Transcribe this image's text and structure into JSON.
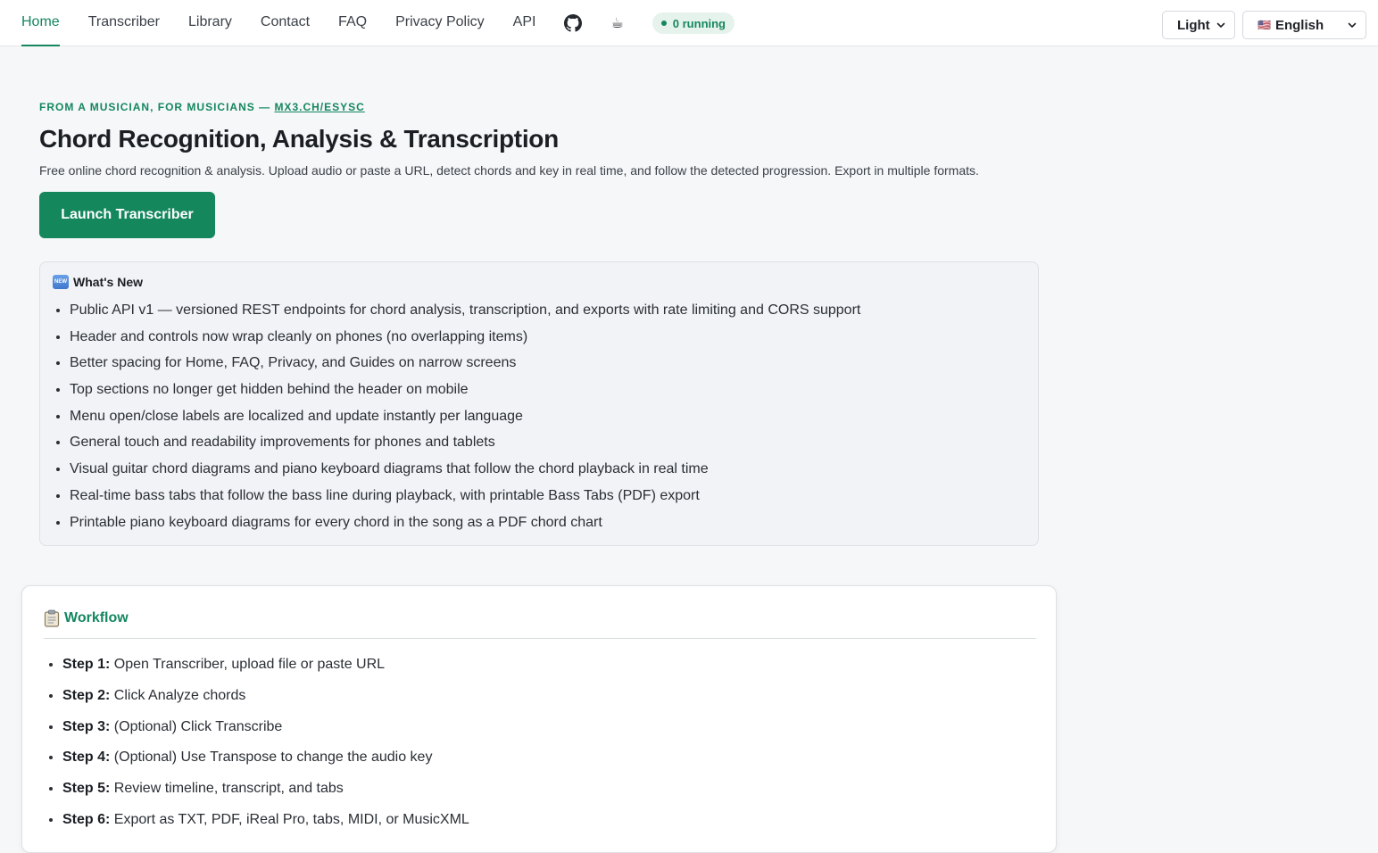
{
  "nav": {
    "items": [
      {
        "label": "Home",
        "active": true
      },
      {
        "label": "Transcriber"
      },
      {
        "label": "Library"
      },
      {
        "label": "Contact"
      },
      {
        "label": "FAQ"
      },
      {
        "label": "Privacy Policy"
      },
      {
        "label": "API"
      }
    ],
    "github_icon": "github-icon",
    "coffee_icon": "coffee-icon",
    "running_status": "0 running",
    "theme_select": "Light",
    "language_flag": "🇺🇸",
    "language_select": "English"
  },
  "hero": {
    "eyebrow_text": "FROM A MUSICIAN, FOR MUSICIANS — ",
    "eyebrow_link": "MX3.CH/ESYSC",
    "title": "Chord Recognition, Analysis & Transcription",
    "subtitle": "Free online chord recognition & analysis. Upload audio or paste a URL, detect chords and key in real time, and follow the detected progression. Export in multiple formats.",
    "launch_button": "Launch Transcriber"
  },
  "whats_new": {
    "badge": "NEW",
    "heading": "What's New",
    "items": [
      "Public API v1 — versioned REST endpoints for chord analysis, transcription, and exports with rate limiting and CORS support",
      "Header and controls now wrap cleanly on phones (no overlapping items)",
      "Better spacing for Home, FAQ, Privacy, and Guides on narrow screens",
      "Top sections no longer get hidden behind the header on mobile",
      "Menu open/close labels are localized and update instantly per language",
      "General touch and readability improvements for phones and tablets",
      "Visual guitar chord diagrams and piano keyboard diagrams that follow the chord playback in real time",
      "Real-time bass tabs that follow the bass line during playback, with printable Bass Tabs (PDF) export",
      "Printable piano keyboard diagrams for every chord in the song as a PDF chord chart"
    ]
  },
  "workflow": {
    "heading": "Workflow",
    "icon": "clipboard-icon",
    "steps": [
      {
        "label": "Step 1:",
        "text": " Open Transcriber, upload file or paste URL"
      },
      {
        "label": "Step 2:",
        "text": " Click Analyze chords"
      },
      {
        "label": "Step 3:",
        "text": " (Optional) Click Transcribe"
      },
      {
        "label": "Step 4:",
        "text": " (Optional) Use Transpose to change the audio key"
      },
      {
        "label": "Step 5:",
        "text": " Review timeline, transcript, and tabs"
      },
      {
        "label": "Step 6:",
        "text": " Export as TXT, PDF, iReal Pro, tabs, MIDI, or MusicXML"
      }
    ]
  },
  "colors": {
    "accent": "#14875d",
    "background": "#f5f7f9"
  }
}
